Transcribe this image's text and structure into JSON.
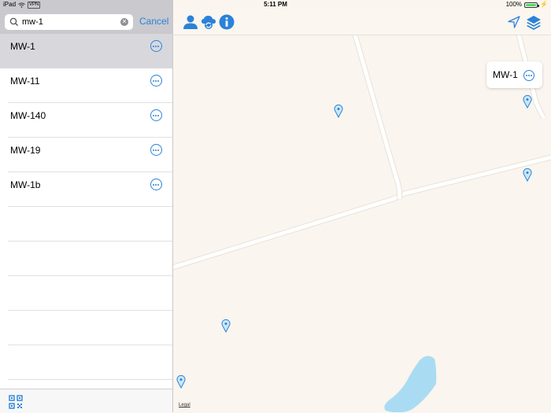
{
  "status": {
    "device": "iPad",
    "vpn": "VPN",
    "time": "5:11 PM",
    "battery": "100%",
    "battery_level": 1.0
  },
  "search": {
    "value": "mw-1",
    "cancel_label": "Cancel"
  },
  "results": [
    {
      "label": "MW-1",
      "selected": true
    },
    {
      "label": "MW-11",
      "selected": false
    },
    {
      "label": "MW-140",
      "selected": false
    },
    {
      "label": "MW-19",
      "selected": false
    },
    {
      "label": "MW-1b",
      "selected": false
    }
  ],
  "map": {
    "callout_label": "MW-1",
    "legal_label": "Legal",
    "colors": {
      "land": "#faf5ee",
      "road": "#ffffff",
      "water": "#a9dcf2",
      "accent": "#2b82d9"
    }
  },
  "icons": [
    "search-icon",
    "clear-icon",
    "more-icon",
    "qr-code-icon",
    "user-icon",
    "cloud-sync-icon",
    "info-icon",
    "location-arrow-icon",
    "layers-icon",
    "map-pin-icon"
  ]
}
